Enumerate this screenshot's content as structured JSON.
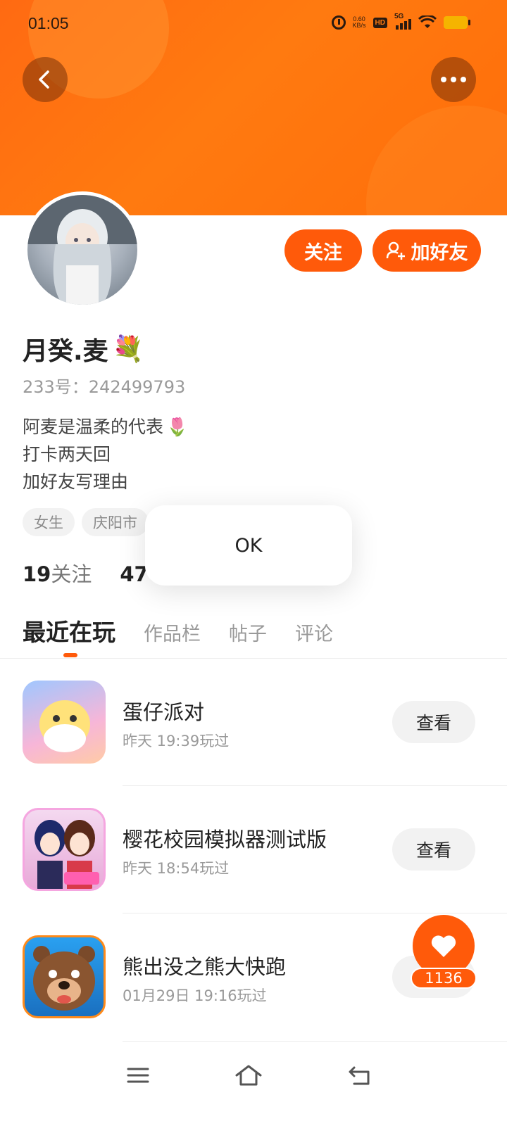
{
  "status_bar": {
    "time": "01:05",
    "net_speed_value": "0.60",
    "net_speed_unit": "KB/s",
    "hd_label": "HD",
    "network_type": "5G",
    "icons": [
      "alarm-icon",
      "hd-icon",
      "signal-icon",
      "wifi-icon",
      "battery-icon"
    ]
  },
  "header": {
    "back_icon": "chevron-left-icon",
    "more_icon": "more-dots-icon",
    "banner_color": "#ff6a12"
  },
  "profile": {
    "name": "月癸.麦",
    "name_emoji": "💐",
    "uid": "233号：242499793",
    "bio_lines": [
      {
        "text": "阿麦是温柔的代表",
        "emoji": "🌷"
      },
      {
        "text": "打卡两天回",
        "emoji": ""
      },
      {
        "text": "加好友写理由",
        "emoji": ""
      }
    ],
    "tags": [
      "女生",
      "庆阳市"
    ]
  },
  "actions": {
    "follow_label": "关注",
    "add_friend_label": "加好友",
    "accent_color": "#ff5a0a"
  },
  "stats": {
    "following_count": "19",
    "following_label": "关注",
    "second_count": "470"
  },
  "tabs": [
    {
      "label": "最近在玩",
      "active": true
    },
    {
      "label": "作品栏",
      "active": false
    },
    {
      "label": "帖子",
      "active": false
    },
    {
      "label": "评论",
      "active": false
    }
  ],
  "games": [
    {
      "title": "蛋仔派对",
      "time": "昨天 19:39玩过",
      "button": "查看"
    },
    {
      "title": "樱花校园模拟器测试版",
      "time": "昨天 18:54玩过",
      "button": "查看"
    },
    {
      "title": "熊出没之熊大快跑",
      "time": "01月29日 19:16玩过",
      "button": "查看"
    }
  ],
  "popup": {
    "label": "OK"
  },
  "like": {
    "count": "1136",
    "icon": "heart-icon"
  },
  "navbar": {
    "icons": [
      "menu-icon",
      "home-icon",
      "back-icon"
    ]
  }
}
